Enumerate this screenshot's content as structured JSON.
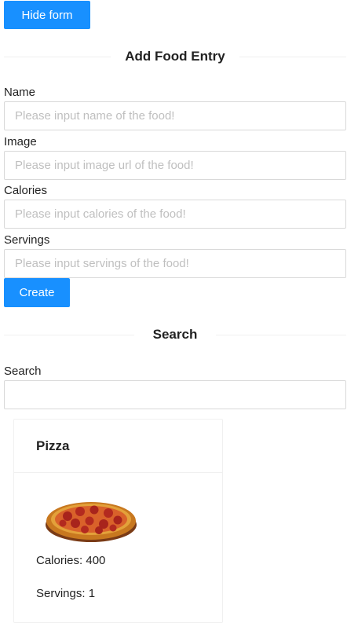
{
  "toggle": {
    "label": "Hide form"
  },
  "form": {
    "title": "Add Food Entry",
    "fields": [
      {
        "label": "Name",
        "placeholder": "Please input name of the food!"
      },
      {
        "label": "Image",
        "placeholder": "Please input image url of the food!"
      },
      {
        "label": "Calories",
        "placeholder": "Please input calories of the food!"
      },
      {
        "label": "Servings",
        "placeholder": "Please input servings of the food!"
      }
    ],
    "submit_label": "Create"
  },
  "search": {
    "title": "Search",
    "label": "Search",
    "value": ""
  },
  "foods": [
    {
      "name": "Pizza",
      "image_icon": "pizza-image",
      "calories": "Calories: 400",
      "servings": "Servings: 1"
    }
  ],
  "colors": {
    "primary": "#1890ff",
    "divider": "#f0f0f0",
    "border": "#d9d9d9"
  }
}
